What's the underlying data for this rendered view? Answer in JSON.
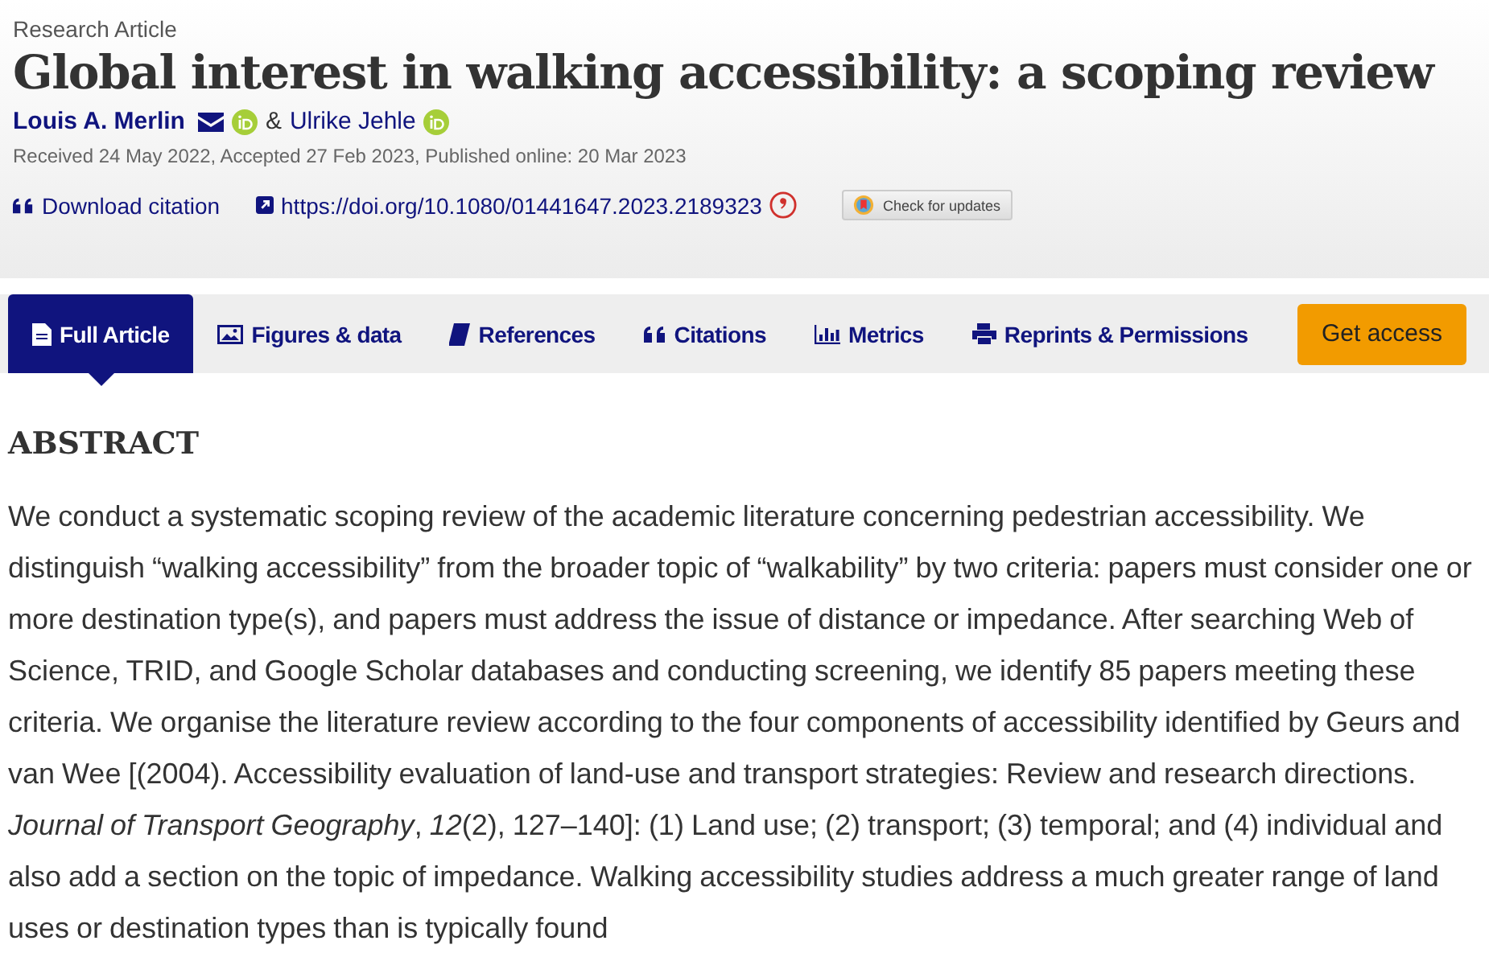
{
  "article_type": "Research Article",
  "title": "Global interest in walking accessibility: a scoping review",
  "authors": [
    {
      "name": "Louis A. Merlin",
      "email": true,
      "orcid": true
    },
    {
      "name": "Ulrike Jehle",
      "email": false,
      "orcid": true
    }
  ],
  "author_separator": "&",
  "dates": "Received 24 May 2022, Accepted 27 Feb 2023, Published online: 20 Mar 2023",
  "links": [
    {
      "kind": "citation",
      "label": "Download citation"
    },
    {
      "kind": "doi",
      "label": "https://doi.org/10.1080/01441647.2023.2189323"
    }
  ],
  "check_updates": "Check for updates",
  "tabs": [
    {
      "kind": "document",
      "label": "Full Article",
      "selected": true
    },
    {
      "kind": "image",
      "label": "Figures & data",
      "selected": false
    },
    {
      "kind": "book",
      "label": "References",
      "selected": false
    },
    {
      "kind": "quote",
      "label": "Citations",
      "selected": false
    },
    {
      "kind": "chart",
      "label": "Metrics",
      "selected": false
    },
    {
      "kind": "printer",
      "label": "Reprints & Permissions",
      "selected": false
    }
  ],
  "access_button": "Get access",
  "abstract": {
    "heading": "ABSTRACT",
    "text": "We conduct a systematic scoping review of the academic literature concerning pedestrian accessibility. We distinguish “walking accessibility” from the broader topic of “walkability” by two criteria: papers must consider one or more destination type(s), and papers must address the issue of distance or impedance. After searching Web of Science, TRID, and Google Scholar databases and conducting screening, we identify 85 papers meeting these criteria. We organise the literature review according to the four components of accessibility identified by Geurs and van Wee [(2004). Accessibility evaluation of land-use and transport strategies: Review and research directions. *Journal of Transport Geography*, *12*(2), 127–140]: (1) Land use; (2) transport; (3) temporal; and (4) individual and also add a section on the topic of impedance. Walking accessibility studies address a much greater range of land uses or destination types than is typically found"
  }
}
